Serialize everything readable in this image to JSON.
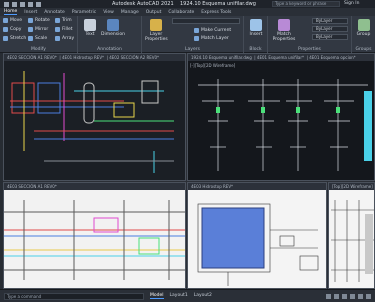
{
  "titlebar": {
    "app_title": "Autodesk AutoCAD 2021",
    "doc_title": "1924.10 Esquema unifilar.dwg",
    "search_placeholder": "Type a keyword or phrase",
    "signin": "Sign In"
  },
  "tabs": [
    "Home",
    "Insert",
    "Annotate",
    "Parametric",
    "View",
    "Manage",
    "Output",
    "Collaborate",
    "Express Tools"
  ],
  "active_tab": "Home",
  "ribbon": {
    "modify": {
      "title": "Modify",
      "tools": [
        "Move",
        "Rotate",
        "Trim",
        "Copy",
        "Mirror",
        "Fillet",
        "Stretch",
        "Scale",
        "Array"
      ]
    },
    "annotation": {
      "title": "Annotation",
      "text": "Text",
      "dimension": "Dimension"
    },
    "layers": {
      "title": "Layers",
      "layer_properties": "Layer Properties",
      "make_current": "Make Current",
      "match_layer": "Match Layer"
    },
    "block": {
      "title": "Block",
      "insert": "Insert"
    },
    "properties": {
      "title": "Properties",
      "label": "Properties",
      "match": "Match Properties",
      "bylayer1": "ByLayer",
      "bylayer2": "ByLayer",
      "bylayer3": "ByLayer"
    },
    "groups": {
      "title": "Groups",
      "label": "Group"
    }
  },
  "viewports": {
    "v1_title": "4E02 SECCIÓN A1 REV0*",
    "v1_tab2": "4E01 Hidrostop REV*",
    "v1_tab3": "4E02 SECCIÓN A2 REV0*",
    "v2_title": "1924.10 Esquema unifilar.dwg",
    "v2_tab2": "4E01 Esquema unifilar*",
    "v2_tab3": "4E01 Esquema opcion*",
    "v3_title": "4E03 SECCIÓN A1 REV0*",
    "v4_title": "4E03 Hidrostop REV*",
    "v5_title": "[Top][2D Wireframe]",
    "v2_view_label": "[-][Top][2D Wireframe]"
  },
  "status": {
    "command_placeholder": "Type a command",
    "layouts": [
      "Model",
      "Layout1",
      "Layout2"
    ],
    "active_layout": "Model"
  },
  "colors": {
    "background": "#1e232a",
    "ribbon": "#323842",
    "accent": "#4f9cff"
  }
}
